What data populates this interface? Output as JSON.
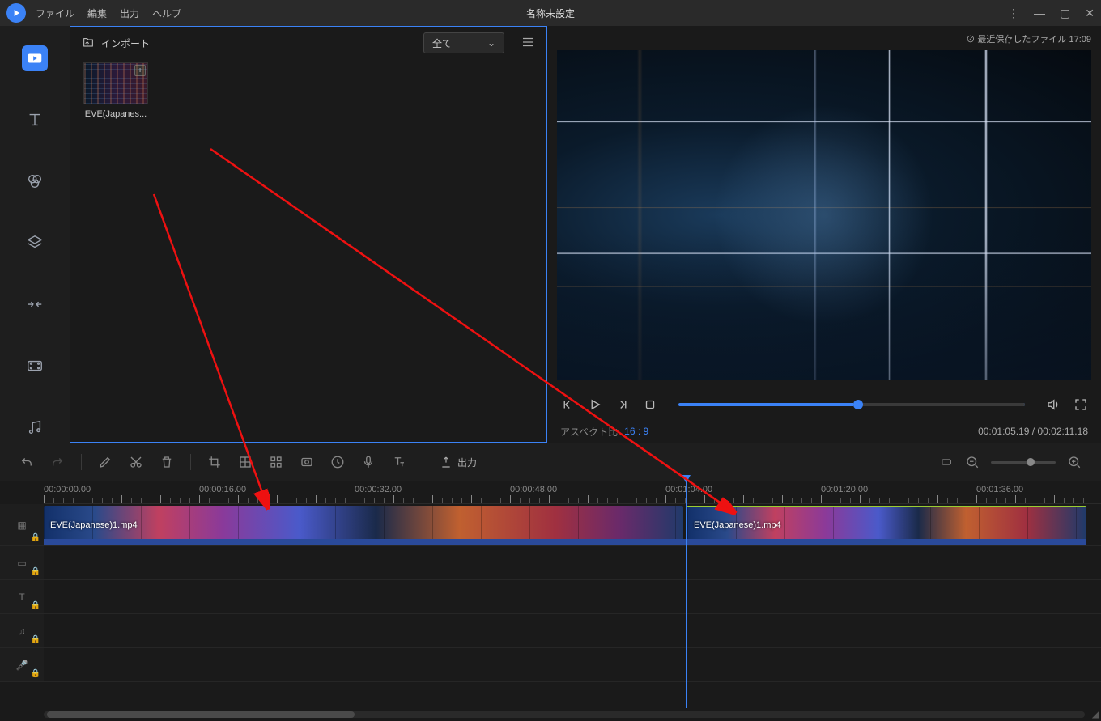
{
  "titlebar": {
    "menu_file": "ファイル",
    "menu_edit": "編集",
    "menu_output": "出力",
    "menu_help": "ヘルプ",
    "title": "名称未設定"
  },
  "saveinfo": {
    "label": "最近保存したファイル",
    "time": "17:09"
  },
  "media": {
    "import_label": "インポート",
    "filter": "全て",
    "item1_label": "EVE(Japanes..."
  },
  "preview": {
    "aspect_label": "アスペクト比",
    "aspect_value": "16 : 9",
    "time_current": "00:01:05.19",
    "time_total": "00:02:11.18",
    "seek_percent": 50
  },
  "toolbar": {
    "export_label": "出力"
  },
  "ruler": {
    "t0": "00:00:00.00",
    "t1": "00:00:16.00",
    "t2": "00:00:32.00",
    "t3": "00:00:48.00",
    "t4": "00:01:04.00",
    "t5": "00:01:20.00",
    "t6": "00:01:36.00"
  },
  "clips": {
    "clip1_label": "EVE(Japanese)1.mp4",
    "clip2_label": "EVE(Japanese)1.mp4"
  }
}
